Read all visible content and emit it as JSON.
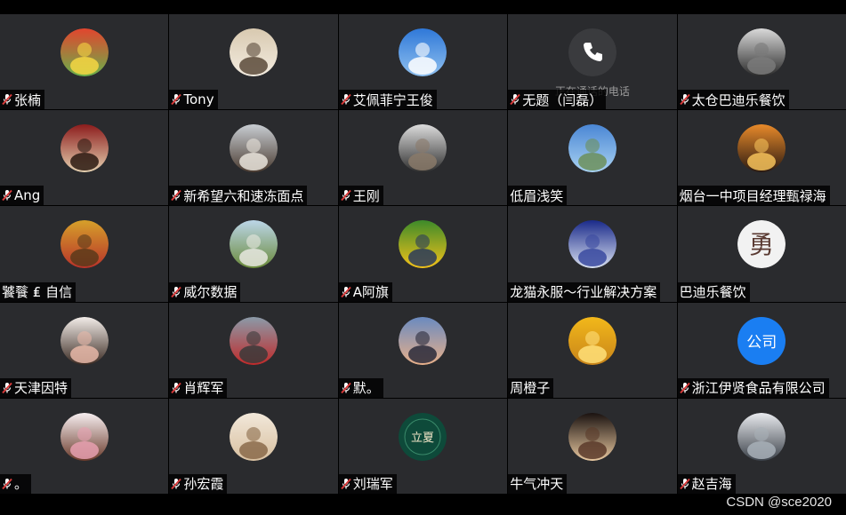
{
  "participants": [
    {
      "name": "张楠",
      "mic": true,
      "avatar": "fruit-photo-avatar",
      "colors": [
        "#e2452e",
        "#6ab04a",
        "#f6d743"
      ]
    },
    {
      "name": "Tony",
      "mic": true,
      "avatar": "dog-photo-avatar",
      "colors": [
        "#d8c9b0",
        "#f3ece0",
        "#5a4a3a"
      ]
    },
    {
      "name": "艾佩菲宁王俊",
      "mic": true,
      "avatar": "sky-photo-avatar",
      "colors": [
        "#2f78d8",
        "#8fc0ef",
        "#ffffff"
      ]
    },
    {
      "name": "无题（闫磊）",
      "mic": true,
      "avatar": "phone-icon",
      "status": "正在通话的电话",
      "colors": [
        "#3a3b3e",
        "#ffffff"
      ]
    },
    {
      "name": "太仓巴迪乐餐饮",
      "mic": true,
      "avatar": "person-photo-avatar",
      "colors": [
        "#d9d9d9",
        "#2a2a2a",
        "#7a7a7a"
      ]
    },
    {
      "name": "Ang",
      "mic": true,
      "avatar": "food-photo-avatar",
      "colors": [
        "#8c1c1c",
        "#e4d0b0",
        "#2b1a12"
      ]
    },
    {
      "name": "新希望六和速冻面点",
      "mic": true,
      "avatar": "woman-car-photo-avatar",
      "colors": [
        "#c8cdd2",
        "#4a3b30",
        "#e9e4dc"
      ]
    },
    {
      "name": "王刚",
      "mic": true,
      "avatar": "man-photo-avatar",
      "colors": [
        "#dcdcdc",
        "#2e2e2e",
        "#8a7a6a"
      ]
    },
    {
      "name": "低眉浅笑",
      "mic": false,
      "avatar": "sky-clouds-photo-avatar",
      "colors": [
        "#4a86d4",
        "#a9d2f2",
        "#6c8f5a"
      ]
    },
    {
      "name": "烟台一中项目经理甄禄海",
      "mic": false,
      "avatar": "dolphin-sunset-photo-avatar",
      "colors": [
        "#e88a2a",
        "#2a1a12",
        "#f6c25a"
      ]
    },
    {
      "name": "饕餮 ₤ 自信",
      "mic": false,
      "avatar": "lion-dance-photo-avatar",
      "colors": [
        "#d6a02a",
        "#b8322a",
        "#5a3a1a"
      ]
    },
    {
      "name": "威尔数据",
      "mic": true,
      "avatar": "tree-photo-avatar",
      "colors": [
        "#bcd6e8",
        "#6a8a3a",
        "#e8e8e0"
      ]
    },
    {
      "name": "A阿旗",
      "mic": true,
      "avatar": "child-photo-avatar",
      "colors": [
        "#3d8a2a",
        "#f2c21a",
        "#2a3a5a"
      ]
    },
    {
      "name": "龙猫永服～行业解决方案",
      "mic": false,
      "avatar": "event-photo-avatar",
      "colors": [
        "#1a2a8a",
        "#d8e0f0",
        "#3a4aa0"
      ]
    },
    {
      "name": "巴迪乐餐饮",
      "mic": false,
      "avatar": "calligraphy-logo-avatar",
      "glyph": "勇",
      "colors": [
        "#f2f2f2",
        "#5a3a32"
      ]
    },
    {
      "name": "天津因特",
      "mic": true,
      "avatar": "woman-portrait-photo-avatar",
      "colors": [
        "#f2ece8",
        "#3a2a22",
        "#e8b8a8"
      ]
    },
    {
      "name": "肖辉军",
      "mic": true,
      "avatar": "bridge-photo-avatar",
      "colors": [
        "#8a9aa8",
        "#c02a2a",
        "#3a3a3a"
      ]
    },
    {
      "name": "默。",
      "mic": true,
      "avatar": "beach-sunset-photo-avatar",
      "colors": [
        "#6a8ac0",
        "#e8b08a",
        "#2a2a3a"
      ]
    },
    {
      "name": "周橙子",
      "mic": false,
      "avatar": "orange-pattern-avatar",
      "colors": [
        "#f2b81a",
        "#c8841a",
        "#ffe07a"
      ]
    },
    {
      "name": "浙江伊贤食品有限公司",
      "mic": true,
      "avatar": "company-text-avatar",
      "glyph": "公司",
      "colors": [
        "#1a7ef2",
        "#ffffff"
      ]
    },
    {
      "name": "。",
      "mic": true,
      "avatar": "anime-girl-avatar",
      "colors": [
        "#f6eef0",
        "#6a3a2a",
        "#e8a0b0"
      ]
    },
    {
      "name": "孙宏霞",
      "mic": true,
      "avatar": "hand-drawing-avatar",
      "colors": [
        "#f2e8da",
        "#d8c0a0",
        "#8a6a4a"
      ]
    },
    {
      "name": "刘瑞军",
      "mic": true,
      "avatar": "poster-lixia-avatar",
      "glyph": "立夏",
      "colors": [
        "#0e4a3a",
        "#f2e6c8",
        "#3a8a6a"
      ]
    },
    {
      "name": "牛气冲天",
      "mic": false,
      "avatar": "dark-portrait-avatar",
      "colors": [
        "#1a1210",
        "#e8c8a0",
        "#5a3a2a"
      ]
    },
    {
      "name": "赵吉海",
      "mic": true,
      "avatar": "mountain-lake-avatar",
      "colors": [
        "#e8eaee",
        "#3a4048",
        "#a8b0b8"
      ]
    }
  ],
  "footer": {
    "credit": "CSDN @sce2020"
  },
  "theme": {
    "tile_bg": "#2a2b2e",
    "mic_red": "#d93a3a"
  }
}
